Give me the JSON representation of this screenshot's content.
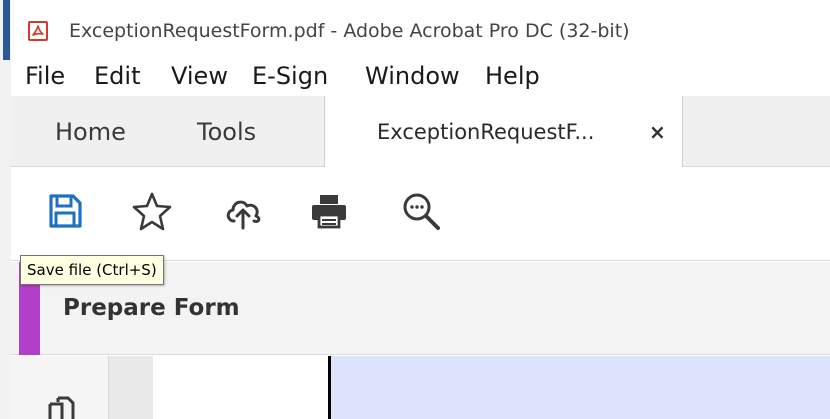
{
  "window": {
    "title": "ExceptionRequestForm.pdf - Adobe Acrobat Pro DC (32-bit)",
    "app_icon": "acrobat-icon"
  },
  "menu": {
    "items": [
      "File",
      "Edit",
      "View",
      "E-Sign",
      "Window",
      "Help"
    ]
  },
  "tabs": {
    "home": "Home",
    "tools": "Tools",
    "document": "ExceptionRequestF...",
    "close_glyph": "×"
  },
  "toolbar": {
    "icons": [
      "save-icon",
      "star-icon",
      "cloud-upload-icon",
      "print-icon",
      "zoom-search-icon"
    ],
    "tooltip": "Save file (Ctrl+S)"
  },
  "panel": {
    "title": "Prepare Form",
    "accent_color": "#b23fc7"
  },
  "colors": {
    "save_icon": "#1f6fc5",
    "acrobat_red": "#d33a2c",
    "page_highlight": "#dde3fb"
  }
}
